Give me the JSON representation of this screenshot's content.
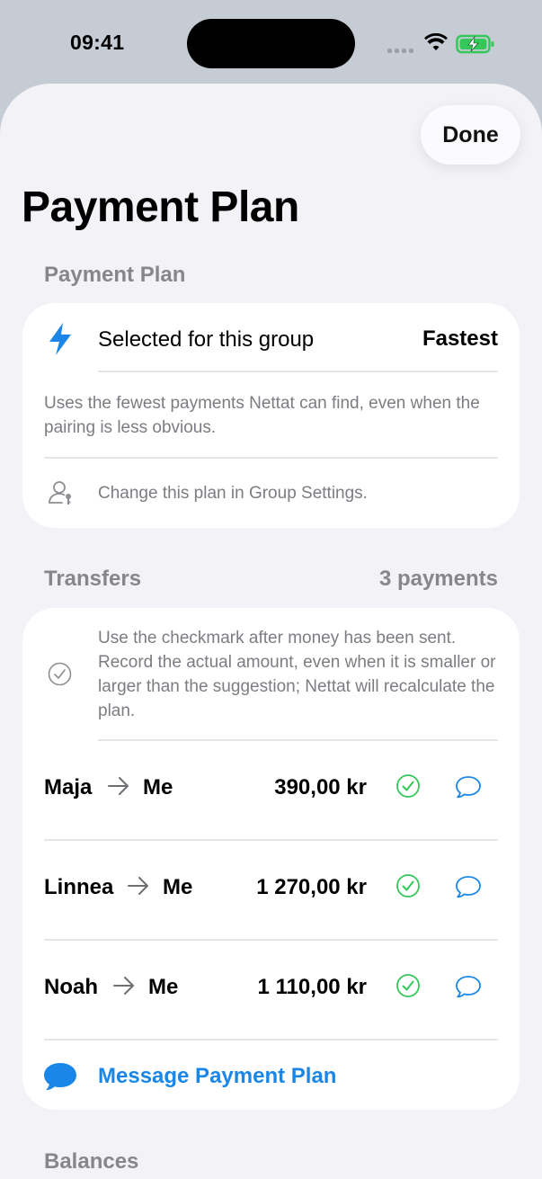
{
  "status_bar": {
    "time": "09:41"
  },
  "sheet": {
    "done_label": "Done",
    "title": "Payment Plan",
    "plan_section": {
      "header": "Payment Plan",
      "icon": "bolt-icon",
      "selected_label": "Selected for this group",
      "selected_value": "Fastest",
      "description": "Uses the fewest payments Nettat can find, even when the pairing is less obvious.",
      "hint": "Change this plan in Group Settings."
    },
    "transfers_section": {
      "header": "Transfers",
      "count": "3 payments",
      "note": "Use the checkmark after money has been sent. Record the actual amount, even when it is smaller or larger than the suggestion; Nettat will recalculate the plan.",
      "rows": [
        {
          "from": "Maja",
          "to": "Me",
          "amount": "390,00 kr"
        },
        {
          "from": "Linnea",
          "to": "Me",
          "amount": "1 270,00 kr"
        },
        {
          "from": "Noah",
          "to": "Me",
          "amount": "1 110,00 kr"
        }
      ],
      "message_link": "Message Payment Plan"
    },
    "balances_section": {
      "header": "Balances"
    }
  },
  "colors": {
    "accent": "#1a87e8",
    "success": "#34c759",
    "secondary_text": "#7c7c82"
  }
}
